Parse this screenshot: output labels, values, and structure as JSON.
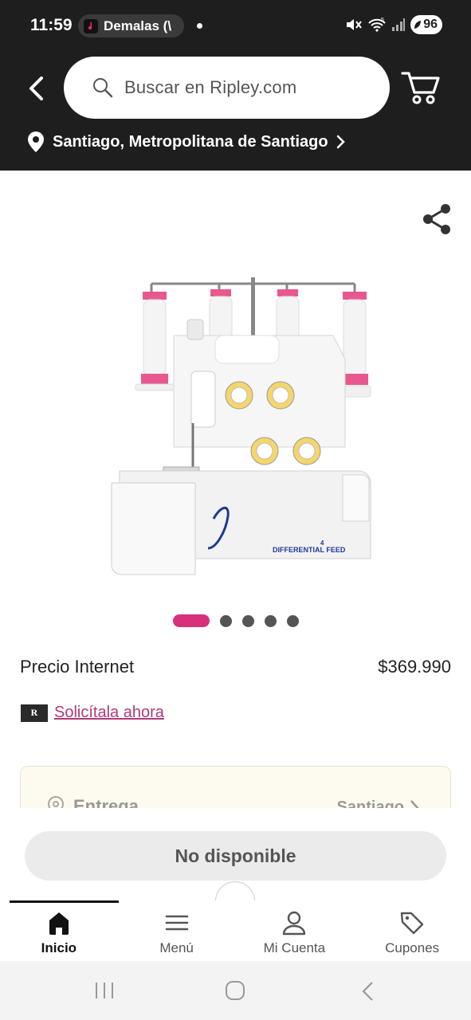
{
  "status_bar": {
    "time": "11:59",
    "notification_pill": "Demalas (\\",
    "battery": "96",
    "signal_label": "5"
  },
  "header": {
    "search_placeholder": "Buscar en Ripley.com",
    "location": "Santiago, Metropolitana de Santiago"
  },
  "gallery": {
    "image_count": 5,
    "active_index": 0,
    "accent_color": "#d8307a"
  },
  "product": {
    "price_label": "Precio Internet",
    "price_value": "$369.990",
    "credit_logo": "R",
    "credit_link": "Solicítala ahora"
  },
  "delivery": {
    "title": "Entrega",
    "city": "Santiago"
  },
  "cta": {
    "label": "No disponible"
  },
  "bottom_nav": {
    "items": [
      {
        "label": "Inicio",
        "icon": "home-icon",
        "active": true
      },
      {
        "label": "Menú",
        "icon": "menu-icon",
        "active": false
      },
      {
        "label": "Mi Cuenta",
        "icon": "user-icon",
        "active": false
      },
      {
        "label": "Cupones",
        "icon": "tag-icon",
        "active": false
      }
    ]
  }
}
